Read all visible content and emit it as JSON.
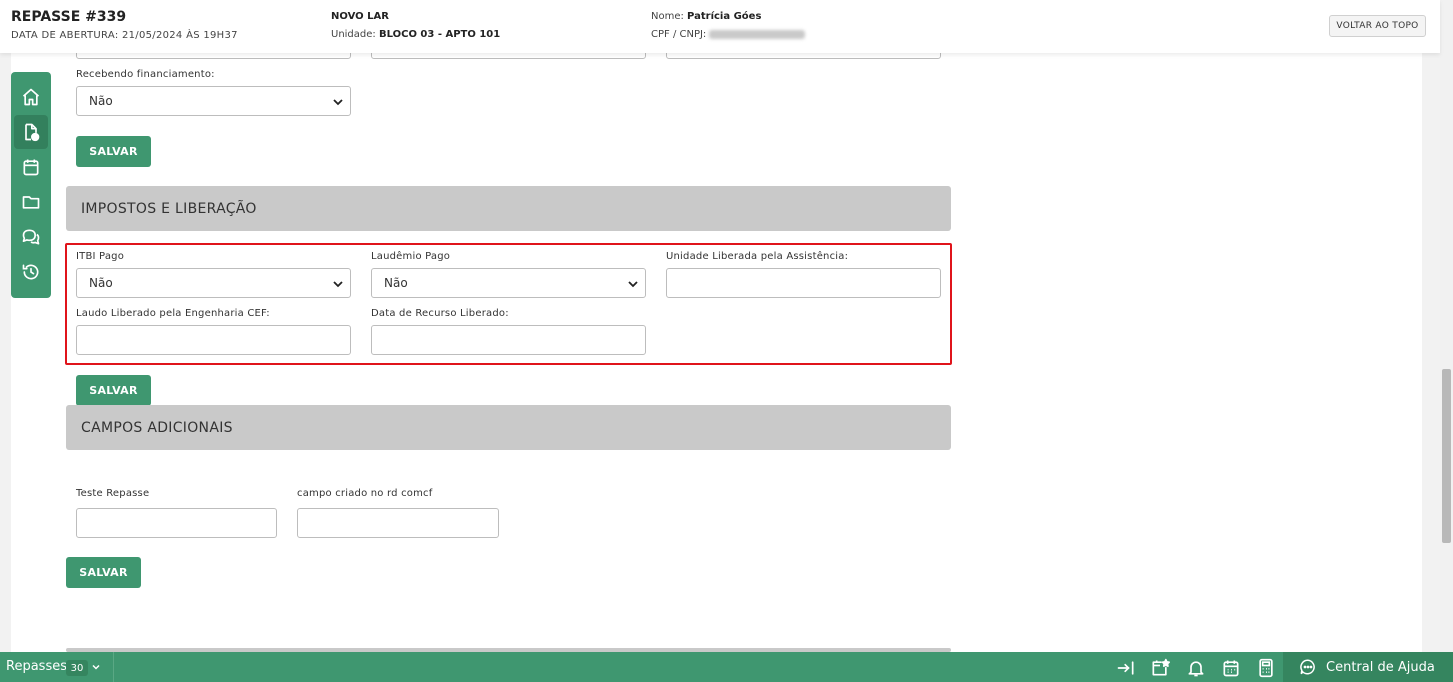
{
  "header": {
    "title": "REPASSE #339",
    "open_date": "DATA DE ABERTURA: 21/05/2024 ÀS 19H37",
    "project": "NOVO LAR",
    "unit_label": "Unidade: ",
    "unit_value": "BLOCO 03 - APTO 101",
    "name_label": "Nome: ",
    "name_value": "Patrícia Góes",
    "cpf_label": "CPF / CNPJ: ",
    "back_to_top": "VOLTAR AO TOPO"
  },
  "sidebar": {
    "items": [
      {
        "icon": "home-icon"
      },
      {
        "icon": "document-icon",
        "active": true
      },
      {
        "icon": "calendar-icon"
      },
      {
        "icon": "folder-icon"
      },
      {
        "icon": "chat-icon"
      },
      {
        "icon": "history-icon"
      }
    ]
  },
  "financing": {
    "label": "Recebendo financiamento:",
    "value": "Não",
    "save": "SALVAR"
  },
  "taxes": {
    "section_title": "IMPOSTOS E LIBERAÇÃO",
    "itbi_label": "ITBI Pago",
    "itbi_value": "Não",
    "laudemio_label": "Laudêmio Pago",
    "laudemio_value": "Não",
    "unit_released_label": "Unidade Liberada pela Assistência:",
    "unit_released_value": "",
    "laudo_label": "Laudo Liberado pela Engenharia CEF:",
    "laudo_value": "",
    "resource_date_label": "Data de Recurso Liberado:",
    "resource_date_value": "",
    "save": "SALVAR"
  },
  "additional": {
    "section_title": "CAMPOS ADICIONAIS",
    "field1_label": "Teste Repasse",
    "field1_value": "",
    "field2_label": "campo criado no rd comcf",
    "field2_value": "",
    "save": "SALVAR"
  },
  "footer": {
    "repasses_label": "Repasses",
    "repasses_count": "30",
    "help_label": "Central de Ajuda"
  },
  "colors": {
    "brand_green": "#3f9770",
    "highlight_red": "#e0141b",
    "section_gray": "#c9c9c9"
  }
}
